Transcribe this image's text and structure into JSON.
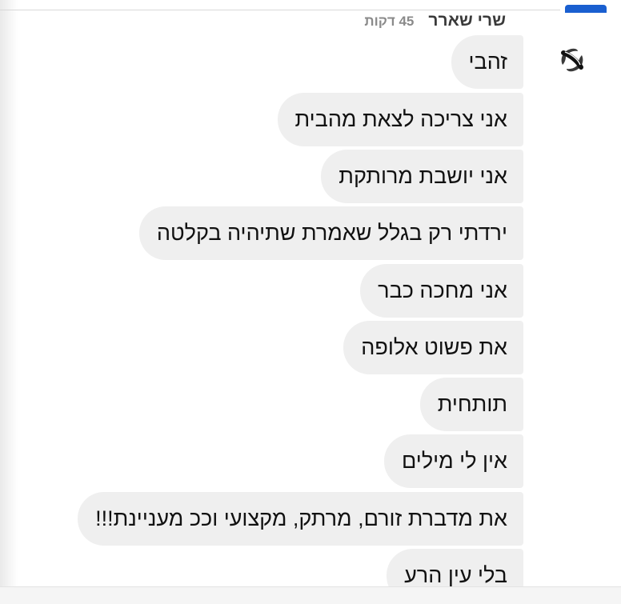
{
  "header": {
    "sender_name": "שרי שארר",
    "time_ago": "45 דקות"
  },
  "avatar": {
    "icon": "s-logo-icon"
  },
  "messages": [
    "זהבי",
    "אני צריכה לצאת מהבית",
    "אני יושבת מרותקת",
    "ירדתי רק בגלל שאמרת שתיהיה בקלטה",
    "אני מחכה כבר",
    "את פשוט אלופה",
    "תותחית",
    "אין לי מילים",
    "את מדברת זורם, מרתק, מקצועי וככ מעניינת!!!",
    "בלי עין הרע"
  ],
  "colors": {
    "bubble": "#efefef",
    "text": "#111111",
    "accent": "#1a5fd0"
  }
}
